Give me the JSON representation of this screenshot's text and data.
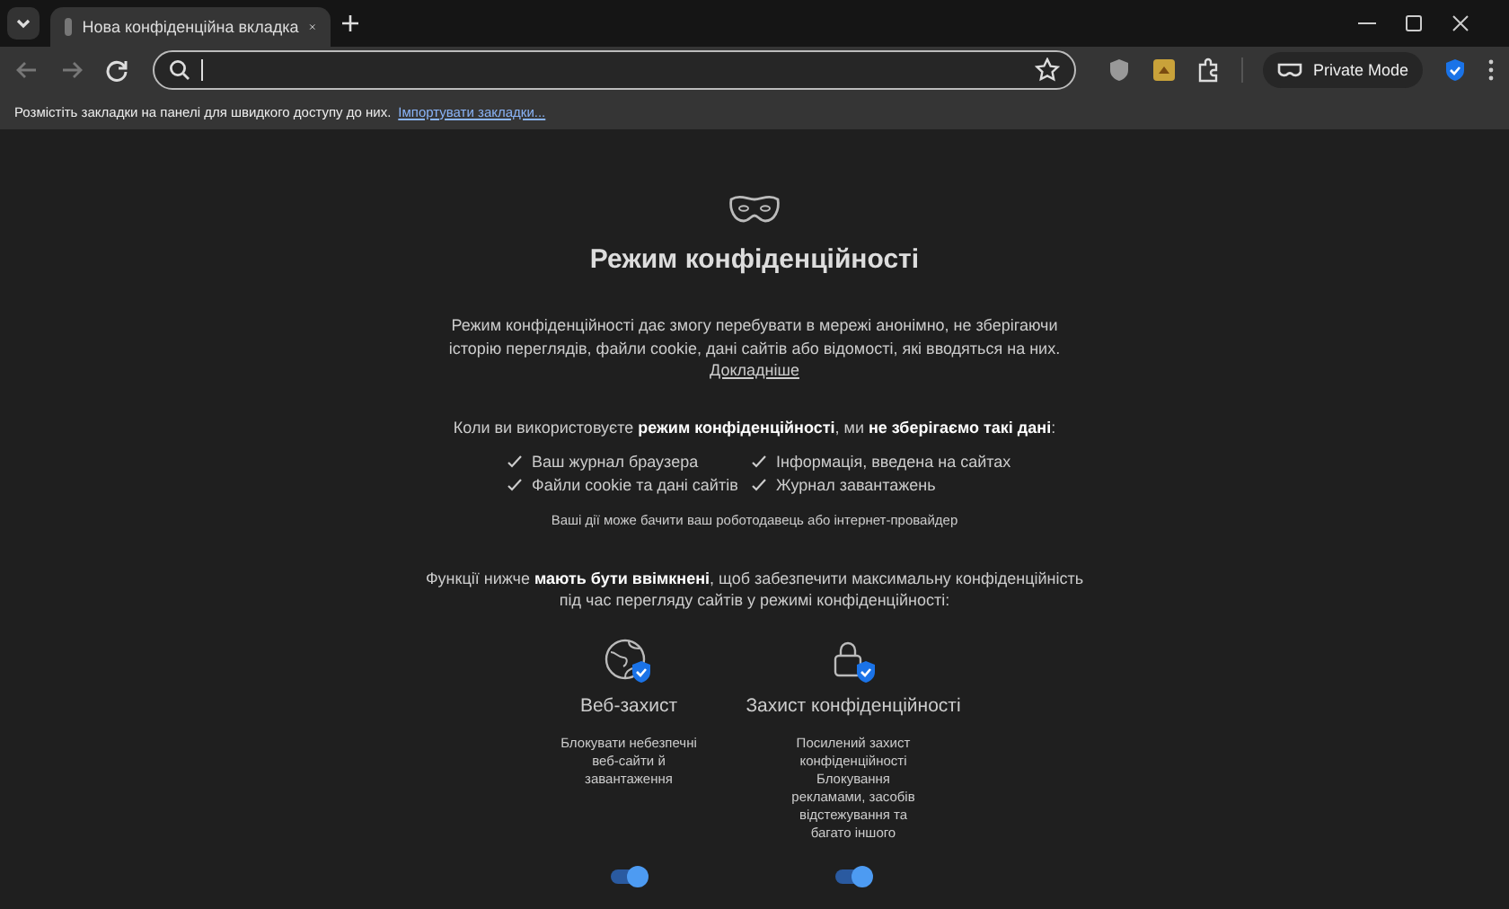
{
  "tabs": [
    {
      "title": "Нова конфіденційна вкладка",
      "selected": true
    }
  ],
  "toolbar": {
    "private_mode": "Private Mode"
  },
  "bookmarks_bar": {
    "text": "Розмістіть закладки на панелі для швидкого доступу до них.",
    "link": "Імпортувати закладки..."
  },
  "page": {
    "title": "Режим конфіденційності",
    "intro": "Режим конфіденційності дає змогу перебувати в мережі анонімно, не зберігаючи історію переглядів, файли cookie, дані сайтів або відомості, які вводяться на них.",
    "learn_more": "Докладніше",
    "not_saved_heading": "Коли ви використовуєте **режим конфіденційності**, ми **не зберігаємо такі дані**:",
    "not_saved": [
      "Ваш журнал браузера",
      "Інформація, введена на сайтах",
      "Файли cookie та дані сайтів",
      "Журнал завантажень"
    ],
    "visible_note": "Ваші дії може бачити ваш роботодавець або інтернет-провайдер",
    "features_heading": "Функції нижче **мають бути ввімкнені**, щоб забезпечити максимальну конфіденційність під час перегляду сайтів у режимі конфіденційності:",
    "features": [
      {
        "kind": "globe",
        "title": "Веб-захист",
        "description": [
          "Блокувати небезпечні веб-сайти й завантаження"
        ],
        "on": true
      },
      {
        "kind": "lock",
        "title": "Захист конфіденційності",
        "description": [
          "Посилений захист конфіденційності",
          "Блокування рекламами, засобів відстежування та багато іншого"
        ],
        "on": true
      }
    ]
  }
}
